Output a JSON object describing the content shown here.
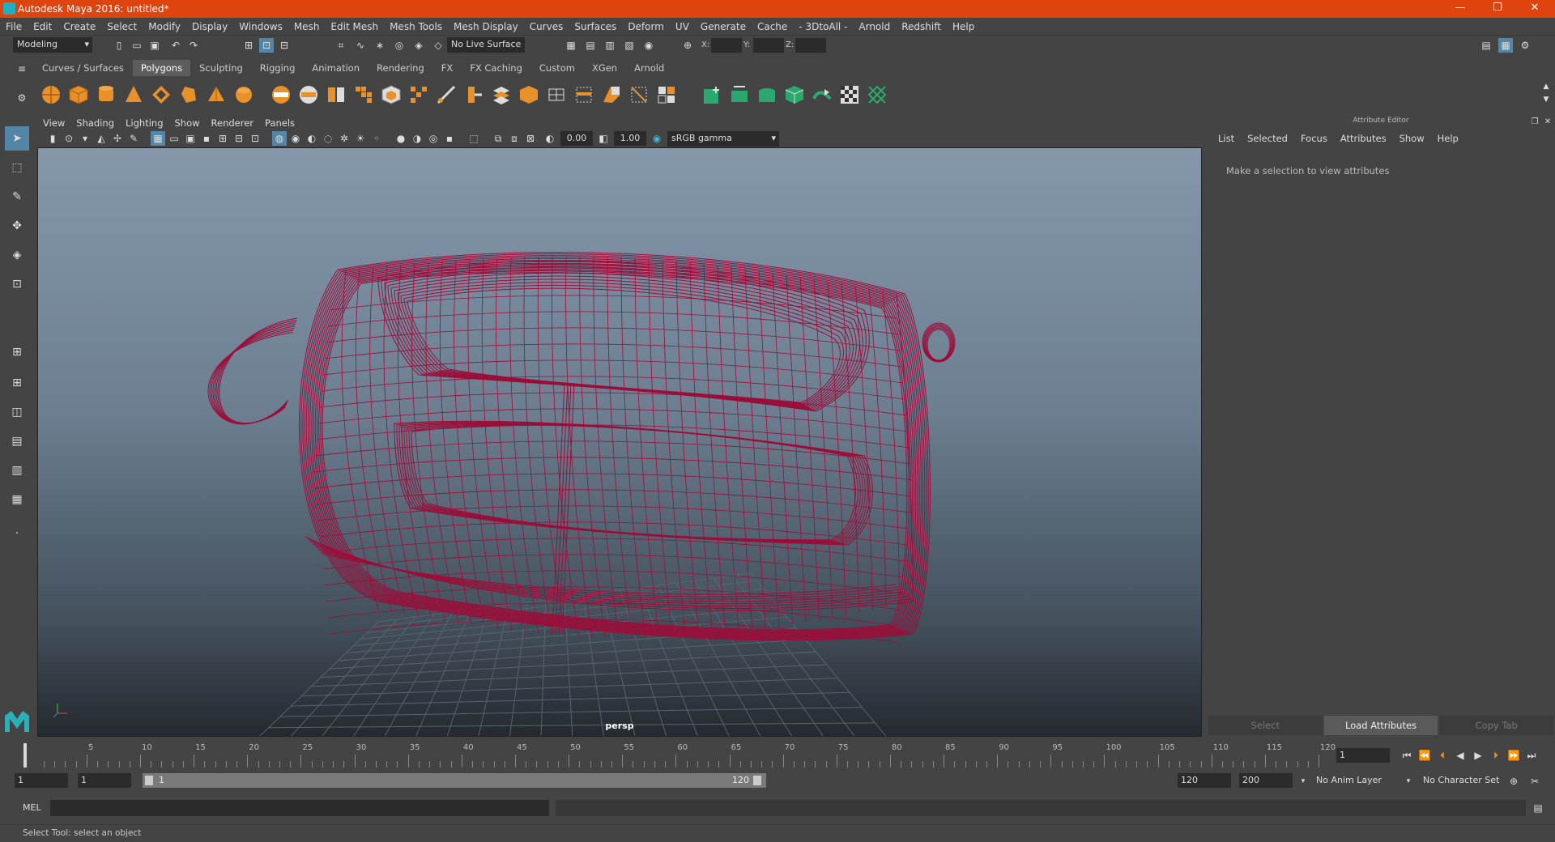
{
  "title": "Autodesk Maya 2016: untitled*",
  "menus": [
    "File",
    "Edit",
    "Create",
    "Select",
    "Modify",
    "Display",
    "Windows",
    "Mesh",
    "Edit Mesh",
    "Mesh Tools",
    "Mesh Display",
    "Curves",
    "Surfaces",
    "Deform",
    "UV",
    "Generate",
    "Cache",
    "- 3DtoAll -",
    "Arnold",
    "Redshift",
    "Help"
  ],
  "status": {
    "mode": "Modeling",
    "live_surface": "No Live Surface",
    "x_label": "X:",
    "y_label": "Y:",
    "z_label": "Z:"
  },
  "shelf_tabs": [
    {
      "label": "Curves / Surfaces"
    },
    {
      "label": "Polygons",
      "active": true
    },
    {
      "label": "Sculpting"
    },
    {
      "label": "Rigging"
    },
    {
      "label": "Animation"
    },
    {
      "label": "Rendering"
    },
    {
      "label": "FX"
    },
    {
      "label": "FX Caching"
    },
    {
      "label": "Custom"
    },
    {
      "label": "XGen"
    },
    {
      "label": "Arnold"
    }
  ],
  "viewport": {
    "menus": [
      "View",
      "Shading",
      "Lighting",
      "Show",
      "Renderer",
      "Panels"
    ],
    "exposure": "0.00",
    "gamma": "1.00",
    "colorspace": "sRGB gamma",
    "camera": "persp",
    "wire_color": "#9b0e3a"
  },
  "attr_editor": {
    "title": "Attribute Editor",
    "menus": [
      "List",
      "Selected",
      "Focus",
      "Attributes",
      "Show",
      "Help"
    ],
    "message": "Make a selection to view attributes",
    "buttons": [
      "Select",
      "Load Attributes",
      "Copy Tab"
    ]
  },
  "timeline": {
    "ticks": [
      "5",
      "10",
      "15",
      "20",
      "25",
      "30",
      "35",
      "40",
      "45",
      "50",
      "55",
      "60",
      "65",
      "70",
      "75",
      "80",
      "85",
      "90",
      "95",
      "100",
      "105",
      "110",
      "115",
      "120"
    ],
    "start_label": "1",
    "current_frame": "1"
  },
  "range": {
    "start": "1",
    "playback_start": "1",
    "slider_start": "1",
    "slider_end": "120",
    "playback_end": "120",
    "end": "200",
    "anim_layer": "No Anim Layer",
    "char_set": "No Character Set"
  },
  "cmd": {
    "label": "MEL"
  },
  "help_line": "Select Tool: select an object"
}
